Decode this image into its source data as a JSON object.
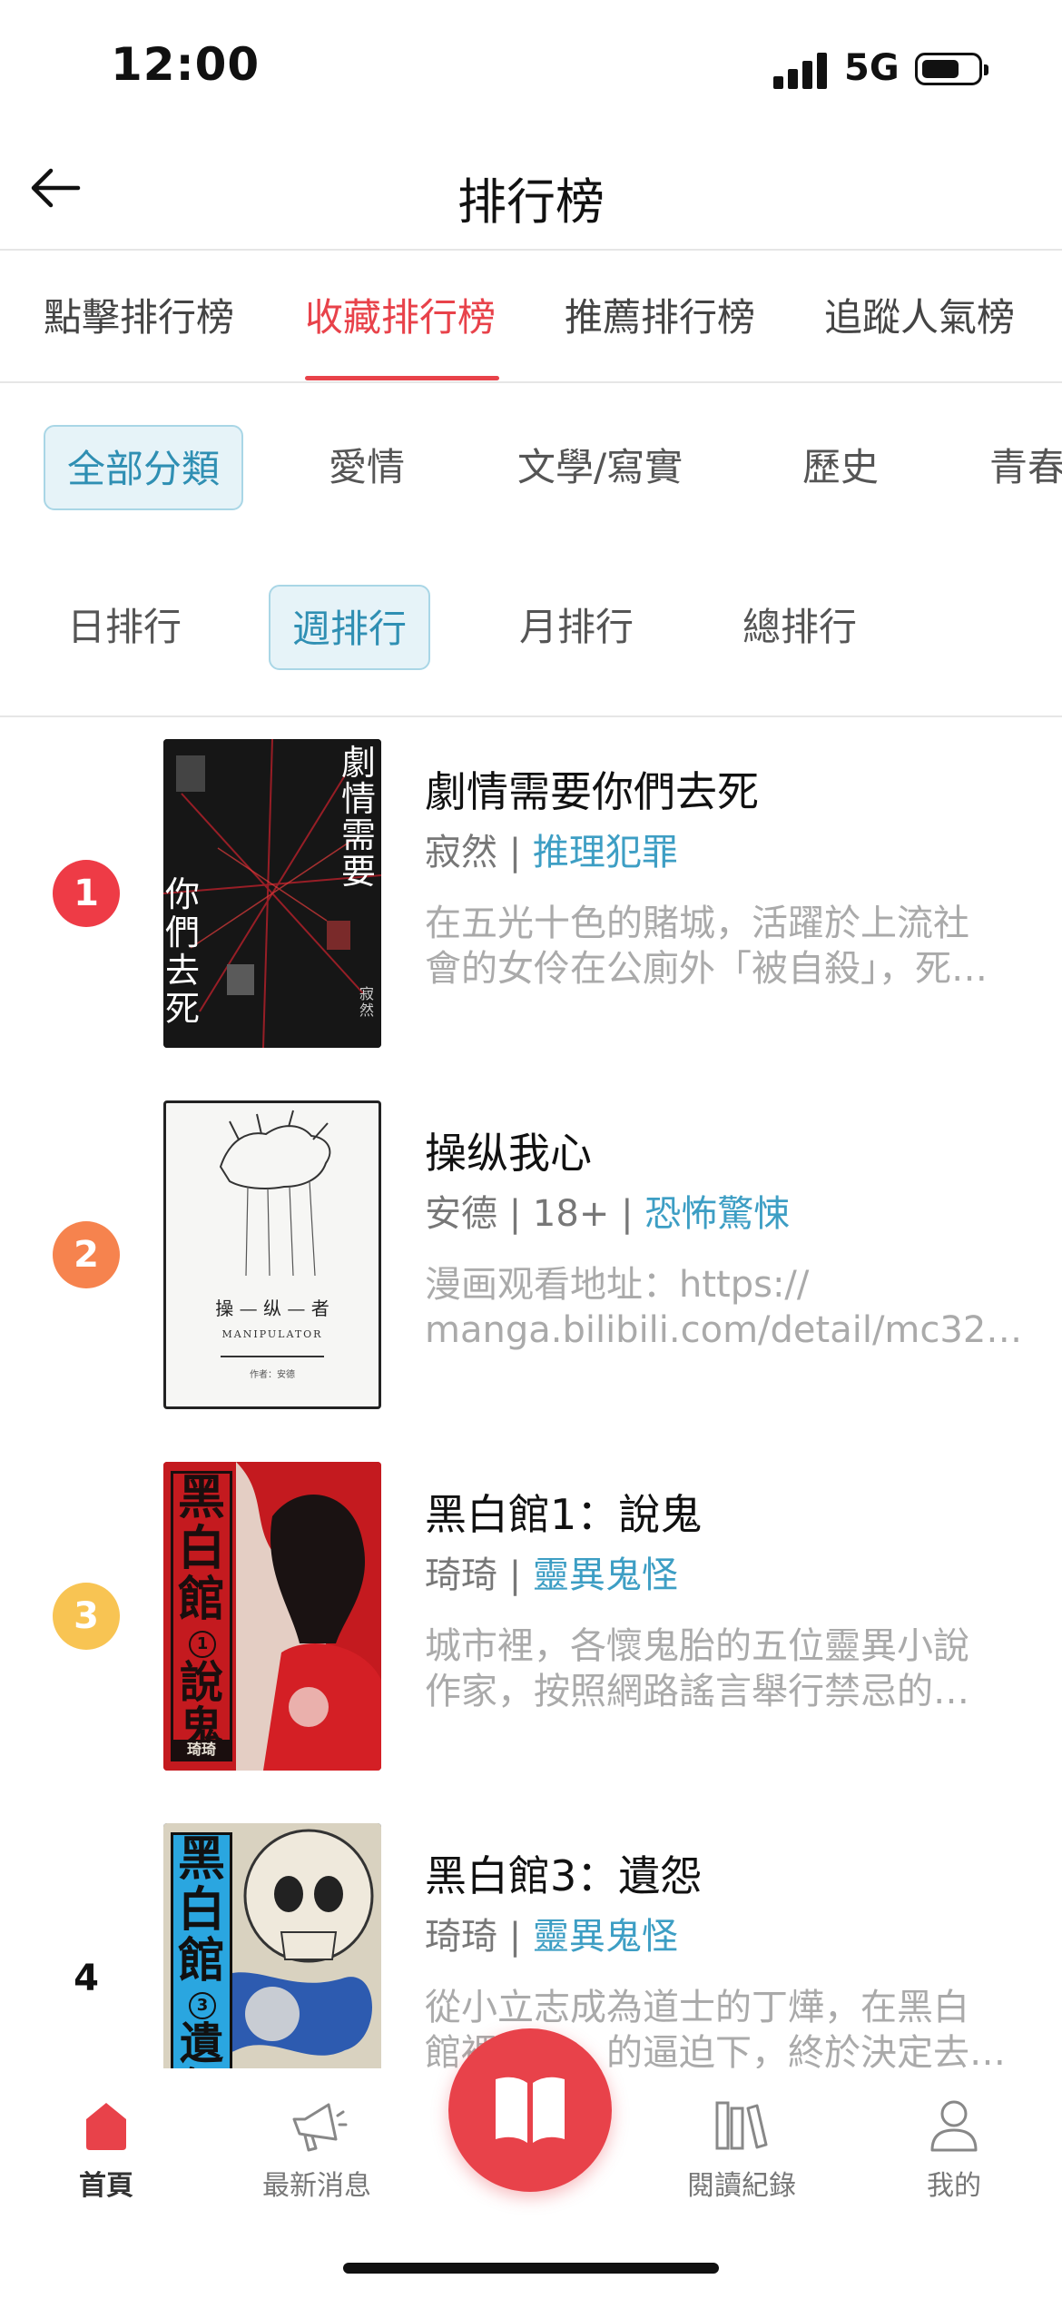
{
  "status": {
    "time": "12:00",
    "network": "5G"
  },
  "header": {
    "title": "排行榜"
  },
  "rank_tabs": [
    {
      "label": "點擊排行榜",
      "active": false
    },
    {
      "label": "收藏排行榜",
      "active": true
    },
    {
      "label": "推薦排行榜",
      "active": false
    },
    {
      "label": "追蹤人氣榜",
      "active": false
    }
  ],
  "categories": [
    {
      "label": "全部分類",
      "active": true
    },
    {
      "label": "愛情",
      "active": false
    },
    {
      "label": "文學/寫實",
      "active": false
    },
    {
      "label": "歷史",
      "active": false
    },
    {
      "label": "青春",
      "active": false
    }
  ],
  "periods": [
    {
      "label": "日排行",
      "active": false
    },
    {
      "label": "週排行",
      "active": true
    },
    {
      "label": "月排行",
      "active": false
    },
    {
      "label": "總排行",
      "active": false
    }
  ],
  "books": [
    {
      "rank": "1",
      "title": "劇情需要你們去死",
      "author": "寂然",
      "sep": "|",
      "genre": "推理犯罪",
      "desc_line1": "在五光十色的賭城，活躍於上流社",
      "desc_line2": "會的女伶在公廁外「被自殺」，死…",
      "cover_text_right": "劇情需要",
      "cover_text_left": "你們去死",
      "cover_author": "寂然"
    },
    {
      "rank": "2",
      "title": "操纵我心",
      "author": "安德",
      "sep": "|",
      "rating": "18+",
      "genre": "恐怖驚悚",
      "desc_line1": "漫画观看地址：https://",
      "desc_line2": "manga.bilibili.com/detail/mc324…",
      "cover_title": "操 — 纵 — 者",
      "cover_subtitle": "MANIPULATOR",
      "cover_author": "作者：安德"
    },
    {
      "rank": "3",
      "title": "黑白館1：說鬼",
      "author": "琦琦",
      "sep": "|",
      "genre": "靈異鬼怪",
      "desc_line1": "城市裡，各懷鬼胎的五位靈異小說",
      "desc_line2": "作家，按照網路謠言舉行禁忌的…",
      "cover_text": "黑白館",
      "cover_vol": "1",
      "cover_sub": "說鬼",
      "cover_author": "琦琦"
    },
    {
      "rank": "4",
      "title": "黑白館3：遺怨",
      "author": "琦琦",
      "sep": "|",
      "genre": "靈異鬼怪",
      "desc_line1": "從小立志成為道士的丁燁，在黑白",
      "desc_line2": "館裡　　　的逼迫下，終於決定去…",
      "cover_text": "黑白館",
      "cover_vol": "3",
      "cover_sub": "遺怨"
    }
  ],
  "tab_bar": [
    {
      "label": "首頁",
      "icon": "home-icon",
      "active": true
    },
    {
      "label": "最新消息",
      "icon": "megaphone-icon",
      "active": false
    },
    {
      "label": "閱讀紀錄",
      "icon": "books-icon",
      "active": false
    },
    {
      "label": "我的",
      "icon": "user-icon",
      "active": false
    }
  ],
  "colors": {
    "accent": "#e8424a",
    "link": "#3d9ec4",
    "rank1": "#ee3b46",
    "rank2": "#f6834e",
    "rank3": "#f8c453"
  }
}
